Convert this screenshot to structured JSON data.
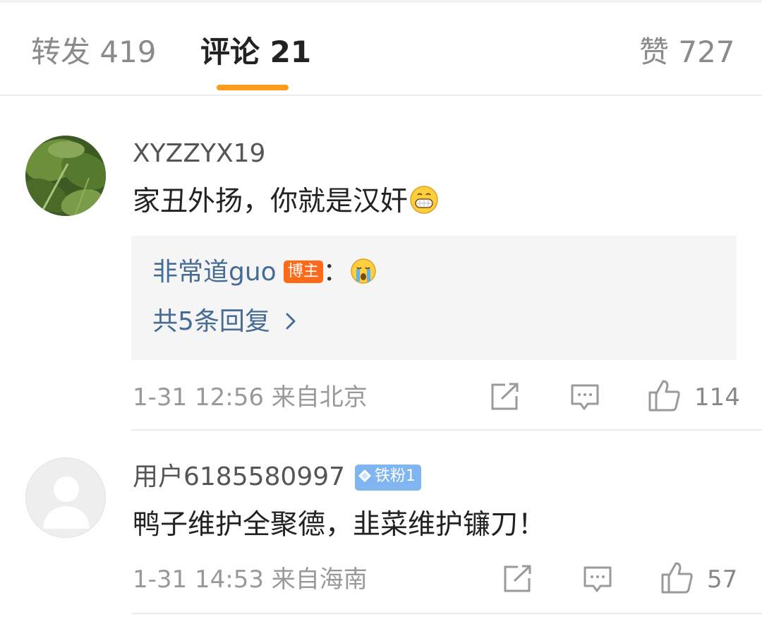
{
  "tabs": {
    "repost": "转发 419",
    "comments": "评论 21",
    "likes": "赞 727"
  },
  "colors": {
    "accent": "#ff9b1a",
    "link": "#466c95",
    "host_badge": "#ff6a1a",
    "fan_badge": "#7fb5f0"
  },
  "comments": [
    {
      "username": "XYZZYX19",
      "text": "家丑外扬，你就是汉奸",
      "text_emoji": "grin-emoji",
      "reply": {
        "author": "非常道guo",
        "badge": "博主",
        "separator": "：",
        "reply_emoji": "crying-emoji",
        "more": "共5条回复"
      },
      "time": "1-31 12:56 来自北京",
      "likes": "114"
    },
    {
      "username": "用户6185580997",
      "badge": "铁粉1",
      "text": "鸭子维护全聚德，韭菜维护镰刀！",
      "time": "1-31 14:53 来自海南",
      "likes": "57"
    }
  ]
}
